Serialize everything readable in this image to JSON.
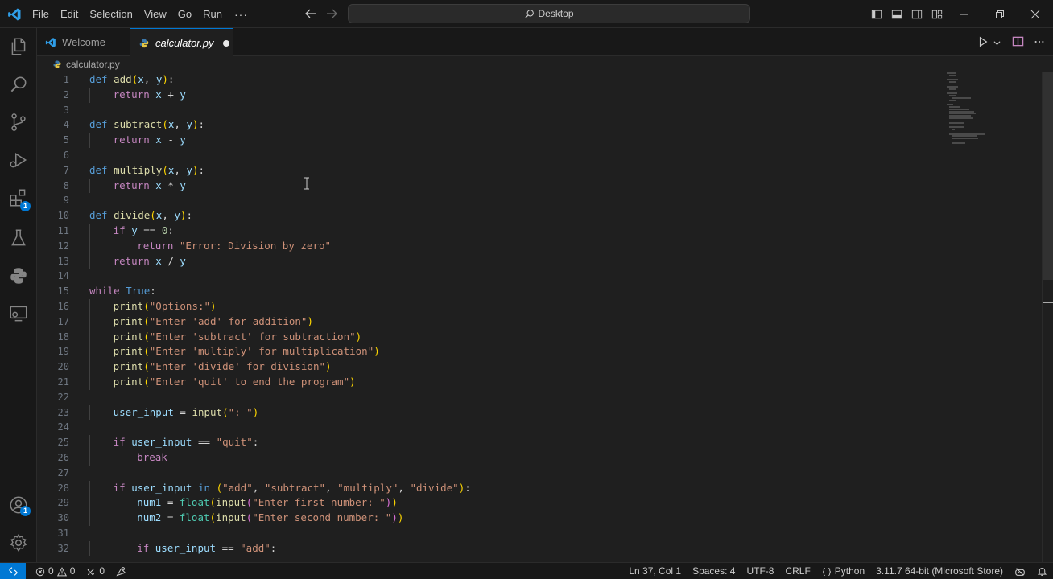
{
  "colors": {
    "accent": "#0078d4",
    "editor_bg": "#1f1f1f",
    "chrome_bg": "#181818",
    "keyword": "#569cd6",
    "control": "#c586c0",
    "function": "#dcdcaa",
    "variable": "#9cdcfe",
    "string": "#ce9178",
    "number": "#b5cea8"
  },
  "titlebar": {
    "menu": [
      "File",
      "Edit",
      "Selection",
      "View",
      "Go",
      "Run"
    ],
    "more": "···",
    "search_text": "Desktop"
  },
  "activity_bar": {
    "icons": [
      "explorer-icon",
      "search-icon",
      "source-control-icon",
      "run-debug-icon",
      "extensions-icon",
      "testing-icon",
      "python-icon",
      "remote-explorer-icon",
      "accounts-icon",
      "manage-gear-icon"
    ],
    "extensions_badge": "1",
    "accounts_badge": "1"
  },
  "tabs": [
    {
      "label": "Welcome",
      "active": false
    },
    {
      "label": "calculator.py",
      "active": true,
      "dirty": true
    }
  ],
  "breadcrumb": {
    "file": "calculator.py"
  },
  "editor": {
    "cursor_line": 37,
    "lines": [
      {
        "n": "1",
        "indent": 0,
        "tokens": [
          [
            "def",
            "kw"
          ],
          [
            " ",
            "op"
          ],
          [
            "add",
            "fn"
          ],
          [
            "(",
            "p1"
          ],
          [
            "x",
            "var"
          ],
          [
            ", ",
            "op"
          ],
          [
            "y",
            "var"
          ],
          [
            ")",
            "p1"
          ],
          [
            ":",
            "op"
          ]
        ]
      },
      {
        "n": "2",
        "indent": 1,
        "tokens": [
          [
            "return",
            "ctl"
          ],
          [
            " ",
            "op"
          ],
          [
            "x",
            "var"
          ],
          [
            " + ",
            "op"
          ],
          [
            "y",
            "var"
          ]
        ]
      },
      {
        "n": "3",
        "indent": 0,
        "tokens": []
      },
      {
        "n": "4",
        "indent": 0,
        "tokens": [
          [
            "def",
            "kw"
          ],
          [
            " ",
            "op"
          ],
          [
            "subtract",
            "fn"
          ],
          [
            "(",
            "p1"
          ],
          [
            "x",
            "var"
          ],
          [
            ", ",
            "op"
          ],
          [
            "y",
            "var"
          ],
          [
            ")",
            "p1"
          ],
          [
            ":",
            "op"
          ]
        ]
      },
      {
        "n": "5",
        "indent": 1,
        "tokens": [
          [
            "return",
            "ctl"
          ],
          [
            " ",
            "op"
          ],
          [
            "x",
            "var"
          ],
          [
            " - ",
            "op"
          ],
          [
            "y",
            "var"
          ]
        ]
      },
      {
        "n": "6",
        "indent": 0,
        "tokens": []
      },
      {
        "n": "7",
        "indent": 0,
        "tokens": [
          [
            "def",
            "kw"
          ],
          [
            " ",
            "op"
          ],
          [
            "multiply",
            "fn"
          ],
          [
            "(",
            "p1"
          ],
          [
            "x",
            "var"
          ],
          [
            ", ",
            "op"
          ],
          [
            "y",
            "var"
          ],
          [
            ")",
            "p1"
          ],
          [
            ":",
            "op"
          ]
        ]
      },
      {
        "n": "8",
        "indent": 1,
        "tokens": [
          [
            "return",
            "ctl"
          ],
          [
            " ",
            "op"
          ],
          [
            "x",
            "var"
          ],
          [
            " * ",
            "op"
          ],
          [
            "y",
            "var"
          ]
        ]
      },
      {
        "n": "9",
        "indent": 0,
        "tokens": []
      },
      {
        "n": "10",
        "indent": 0,
        "tokens": [
          [
            "def",
            "kw"
          ],
          [
            " ",
            "op"
          ],
          [
            "divide",
            "fn"
          ],
          [
            "(",
            "p1"
          ],
          [
            "x",
            "var"
          ],
          [
            ", ",
            "op"
          ],
          [
            "y",
            "var"
          ],
          [
            ")",
            "p1"
          ],
          [
            ":",
            "op"
          ]
        ]
      },
      {
        "n": "11",
        "indent": 1,
        "tokens": [
          [
            "if",
            "ctl"
          ],
          [
            " ",
            "op"
          ],
          [
            "y",
            "var"
          ],
          [
            " == ",
            "op"
          ],
          [
            "0",
            "num"
          ],
          [
            ":",
            "op"
          ]
        ]
      },
      {
        "n": "12",
        "indent": 2,
        "tokens": [
          [
            "return",
            "ctl"
          ],
          [
            " ",
            "op"
          ],
          [
            "\"Error: Division by zero\"",
            "str"
          ]
        ]
      },
      {
        "n": "13",
        "indent": 1,
        "tokens": [
          [
            "return",
            "ctl"
          ],
          [
            " ",
            "op"
          ],
          [
            "x",
            "var"
          ],
          [
            " / ",
            "op"
          ],
          [
            "y",
            "var"
          ]
        ]
      },
      {
        "n": "14",
        "indent": 0,
        "tokens": []
      },
      {
        "n": "15",
        "indent": 0,
        "tokens": [
          [
            "while",
            "ctl"
          ],
          [
            " ",
            "op"
          ],
          [
            "True",
            "kw"
          ],
          [
            ":",
            "op"
          ]
        ]
      },
      {
        "n": "16",
        "indent": 1,
        "tokens": [
          [
            "print",
            "fn"
          ],
          [
            "(",
            "p1"
          ],
          [
            "\"Options:\"",
            "str"
          ],
          [
            ")",
            "p1"
          ]
        ]
      },
      {
        "n": "17",
        "indent": 1,
        "tokens": [
          [
            "print",
            "fn"
          ],
          [
            "(",
            "p1"
          ],
          [
            "\"Enter 'add' for addition\"",
            "str"
          ],
          [
            ")",
            "p1"
          ]
        ]
      },
      {
        "n": "18",
        "indent": 1,
        "tokens": [
          [
            "print",
            "fn"
          ],
          [
            "(",
            "p1"
          ],
          [
            "\"Enter 'subtract' for subtraction\"",
            "str"
          ],
          [
            ")",
            "p1"
          ]
        ]
      },
      {
        "n": "19",
        "indent": 1,
        "tokens": [
          [
            "print",
            "fn"
          ],
          [
            "(",
            "p1"
          ],
          [
            "\"Enter 'multiply' for multiplication\"",
            "str"
          ],
          [
            ")",
            "p1"
          ]
        ]
      },
      {
        "n": "20",
        "indent": 1,
        "tokens": [
          [
            "print",
            "fn"
          ],
          [
            "(",
            "p1"
          ],
          [
            "\"Enter 'divide' for division\"",
            "str"
          ],
          [
            ")",
            "p1"
          ]
        ]
      },
      {
        "n": "21",
        "indent": 1,
        "tokens": [
          [
            "print",
            "fn"
          ],
          [
            "(",
            "p1"
          ],
          [
            "\"Enter 'quit' to end the program\"",
            "str"
          ],
          [
            ")",
            "p1"
          ]
        ]
      },
      {
        "n": "22",
        "indent": 0,
        "tokens": []
      },
      {
        "n": "23",
        "indent": 1,
        "tokens": [
          [
            "user_input",
            "var"
          ],
          [
            " = ",
            "op"
          ],
          [
            "input",
            "fn"
          ],
          [
            "(",
            "p1"
          ],
          [
            "\": \"",
            "str"
          ],
          [
            ")",
            "p1"
          ]
        ]
      },
      {
        "n": "24",
        "indent": 0,
        "tokens": []
      },
      {
        "n": "25",
        "indent": 1,
        "tokens": [
          [
            "if",
            "ctl"
          ],
          [
            " ",
            "op"
          ],
          [
            "user_input",
            "var"
          ],
          [
            " == ",
            "op"
          ],
          [
            "\"quit\"",
            "str"
          ],
          [
            ":",
            "op"
          ]
        ]
      },
      {
        "n": "26",
        "indent": 2,
        "tokens": [
          [
            "break",
            "ctl"
          ]
        ]
      },
      {
        "n": "27",
        "indent": 0,
        "tokens": []
      },
      {
        "n": "28",
        "indent": 1,
        "tokens": [
          [
            "if",
            "ctl"
          ],
          [
            " ",
            "op"
          ],
          [
            "user_input",
            "var"
          ],
          [
            " ",
            "op"
          ],
          [
            "in",
            "kw"
          ],
          [
            " ",
            "op"
          ],
          [
            "(",
            "p1"
          ],
          [
            "\"add\"",
            "str"
          ],
          [
            ", ",
            "op"
          ],
          [
            "\"subtract\"",
            "str"
          ],
          [
            ", ",
            "op"
          ],
          [
            "\"multiply\"",
            "str"
          ],
          [
            ", ",
            "op"
          ],
          [
            "\"divide\"",
            "str"
          ],
          [
            ")",
            "p1"
          ],
          [
            ":",
            "op"
          ]
        ]
      },
      {
        "n": "29",
        "indent": 2,
        "tokens": [
          [
            "num1",
            "var"
          ],
          [
            " = ",
            "op"
          ],
          [
            "float",
            "cls"
          ],
          [
            "(",
            "p1"
          ],
          [
            "input",
            "fn"
          ],
          [
            "(",
            "p2"
          ],
          [
            "\"Enter first number: \"",
            "str"
          ],
          [
            ")",
            "p2"
          ],
          [
            ")",
            "p1"
          ]
        ]
      },
      {
        "n": "30",
        "indent": 2,
        "tokens": [
          [
            "num2",
            "var"
          ],
          [
            " = ",
            "op"
          ],
          [
            "float",
            "cls"
          ],
          [
            "(",
            "p1"
          ],
          [
            "input",
            "fn"
          ],
          [
            "(",
            "p2"
          ],
          [
            "\"Enter second number: \"",
            "str"
          ],
          [
            ")",
            "p2"
          ],
          [
            ")",
            "p1"
          ]
        ]
      },
      {
        "n": "31",
        "indent": 0,
        "tokens": []
      },
      {
        "n": "32",
        "indent": 2,
        "tokens": [
          [
            "if",
            "ctl"
          ],
          [
            " ",
            "op"
          ],
          [
            "user_input",
            "var"
          ],
          [
            " == ",
            "op"
          ],
          [
            "\"add\"",
            "str"
          ],
          [
            ":",
            "op"
          ]
        ]
      }
    ]
  },
  "statusbar": {
    "errors": "0",
    "warnings": "0",
    "ports": "0",
    "position": "Ln 37, Col 1",
    "spaces": "Spaces: 4",
    "encoding": "UTF-8",
    "eol": "CRLF",
    "language": "Python",
    "interpreter": "3.11.7 64-bit (Microsoft Store)"
  }
}
